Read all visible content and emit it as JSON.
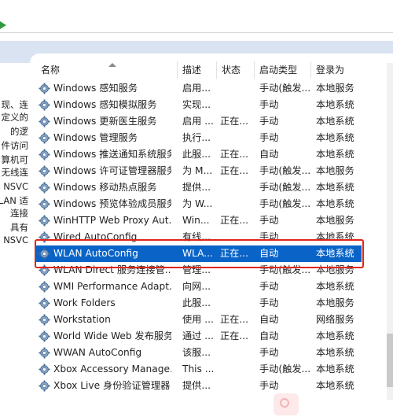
{
  "left_description": [
    "现、连",
    "定义的",
    "的逻",
    "件访问",
    "算机可",
    "无线连",
    "NSVC",
    "LAN 适",
    "连接",
    "具有",
    "NSVC"
  ],
  "columns": {
    "name": "名称",
    "desc": "描述",
    "status": "状态",
    "startup": "启动类型",
    "logon": "登录为"
  },
  "services": [
    {
      "name": "Windows 感知服务",
      "desc": "启用...",
      "status": "",
      "startup": "手动(触发...",
      "logon": "本地服务",
      "selected": false
    },
    {
      "name": "Windows 感知模拟服务",
      "desc": "实现...",
      "status": "",
      "startup": "手动",
      "logon": "本地系统",
      "selected": false
    },
    {
      "name": "Windows 更新医生服务",
      "desc": "启用 ...",
      "status": "正在...",
      "startup": "手动",
      "logon": "本地系统",
      "selected": false
    },
    {
      "name": "Windows 管理服务",
      "desc": "执行...",
      "status": "",
      "startup": "手动",
      "logon": "本地系统",
      "selected": false
    },
    {
      "name": "Windows 推送通知系统服务",
      "desc": "此服...",
      "status": "正在...",
      "startup": "自动",
      "logon": "本地系统",
      "selected": false
    },
    {
      "name": "Windows 许可证管理器服务",
      "desc": "为 M...",
      "status": "正在...",
      "startup": "手动(触发...",
      "logon": "本地服务",
      "selected": false
    },
    {
      "name": "Windows 移动热点服务",
      "desc": "提供...",
      "status": "",
      "startup": "手动(触发...",
      "logon": "本地系统",
      "selected": false
    },
    {
      "name": "Windows 预览体验成员服务",
      "desc": "为 W...",
      "status": "",
      "startup": "手动(触发...",
      "logon": "本地系统",
      "selected": false
    },
    {
      "name": "WinHTTP Web Proxy Aut...",
      "desc": "Win...",
      "status": "正在...",
      "startup": "手动",
      "logon": "本地服务",
      "selected": false
    },
    {
      "name": "Wired AutoConfig",
      "desc": "有线...",
      "status": "",
      "startup": "手动",
      "logon": "本地系统",
      "selected": false
    },
    {
      "name": "WLAN AutoConfig",
      "desc": "WLA...",
      "status": "正在...",
      "startup": "自动",
      "logon": "本地系统",
      "selected": true
    },
    {
      "name": "WLAN Direct 服务连接管...",
      "desc": "管理...",
      "status": "",
      "startup": "手动(触发...",
      "logon": "本地服务",
      "selected": false
    },
    {
      "name": "WMI Performance Adapt...",
      "desc": "向网...",
      "status": "",
      "startup": "手动",
      "logon": "本地系统",
      "selected": false
    },
    {
      "name": "Work Folders",
      "desc": "此服...",
      "status": "",
      "startup": "手动",
      "logon": "本地服务",
      "selected": false
    },
    {
      "name": "Workstation",
      "desc": "使用 ...",
      "status": "正在...",
      "startup": "自动",
      "logon": "网络服务",
      "selected": false
    },
    {
      "name": "World Wide Web 发布服务",
      "desc": "通过 ...",
      "status": "正在...",
      "startup": "自动",
      "logon": "本地系统",
      "selected": false
    },
    {
      "name": "WWAN AutoConfig",
      "desc": "该服...",
      "status": "",
      "startup": "手动",
      "logon": "本地系统",
      "selected": false
    },
    {
      "name": "Xbox Accessory Manage...",
      "desc": "This ...",
      "status": "",
      "startup": "手动(触发...",
      "logon": "本地系统",
      "selected": false
    },
    {
      "name": "Xbox Live 身份验证管理器",
      "desc": "提供...",
      "status": "",
      "startup": "手动",
      "logon": "本地系统",
      "selected": false
    }
  ],
  "colors": {
    "selection": "#0a64c8",
    "highlight_border": "#e0251b",
    "header_band": "#d9e3f2"
  },
  "icons": {
    "service": "gear-icon",
    "sort": "sort-up-icon",
    "toolbar": "play-icon"
  }
}
